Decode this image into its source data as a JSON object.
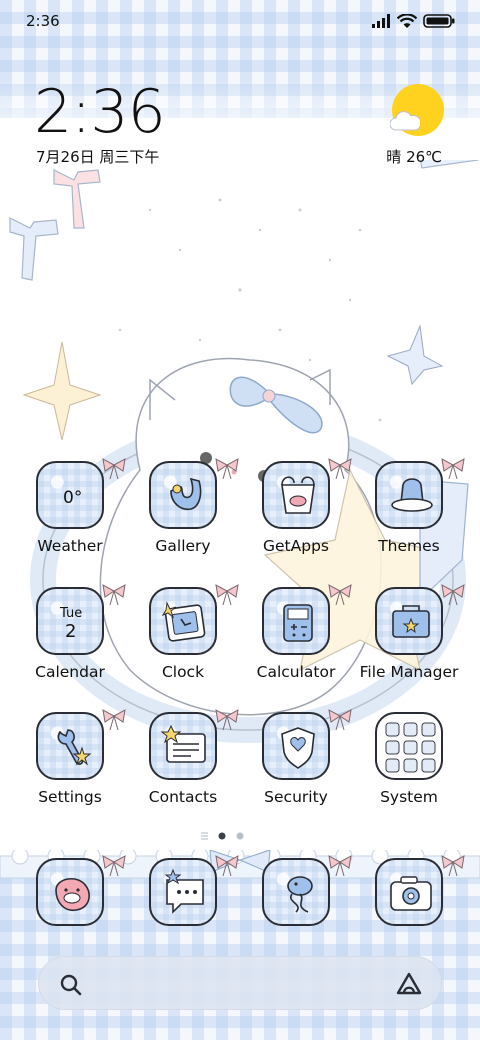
{
  "status_bar": {
    "time": "2:36",
    "icons": [
      "signal-icon",
      "wifi-icon",
      "battery-icon"
    ]
  },
  "clock_widget": {
    "time": "2:36",
    "date": "7月26日 周三下午",
    "weather": "晴 26℃"
  },
  "apps": [
    {
      "label": "Weather",
      "icon": "weather-icon",
      "badge": "0°"
    },
    {
      "label": "Gallery",
      "icon": "gallery-icon"
    },
    {
      "label": "GetApps",
      "icon": "getapps-icon"
    },
    {
      "label": "Themes",
      "icon": "themes-icon"
    },
    {
      "label": "Calendar",
      "icon": "calendar-icon",
      "day": "Tue",
      "date": "2"
    },
    {
      "label": "Clock",
      "icon": "clock-icon"
    },
    {
      "label": "Calculator",
      "icon": "calculator-icon"
    },
    {
      "label": "File Manager",
      "icon": "file-manager-icon"
    },
    {
      "label": "Settings",
      "icon": "settings-icon"
    },
    {
      "label": "Contacts",
      "icon": "contacts-icon"
    },
    {
      "label": "Security",
      "icon": "security-icon"
    },
    {
      "label": "System",
      "icon": "system-folder-icon"
    }
  ],
  "dock": [
    {
      "icon": "phone-icon"
    },
    {
      "icon": "messages-icon"
    },
    {
      "icon": "browser-icon"
    },
    {
      "icon": "camera-icon"
    }
  ],
  "pages": {
    "count": 2,
    "current": 1
  },
  "search": {
    "left_icon": "search-icon",
    "right_icon": "assistant-icon"
  },
  "colors": {
    "sun": "#ffd21f",
    "tile_bg": "#e6effb",
    "outline": "#2a2d35",
    "bow_pink": "#f4c8cc",
    "accent_blue": "#9fc0ea"
  }
}
